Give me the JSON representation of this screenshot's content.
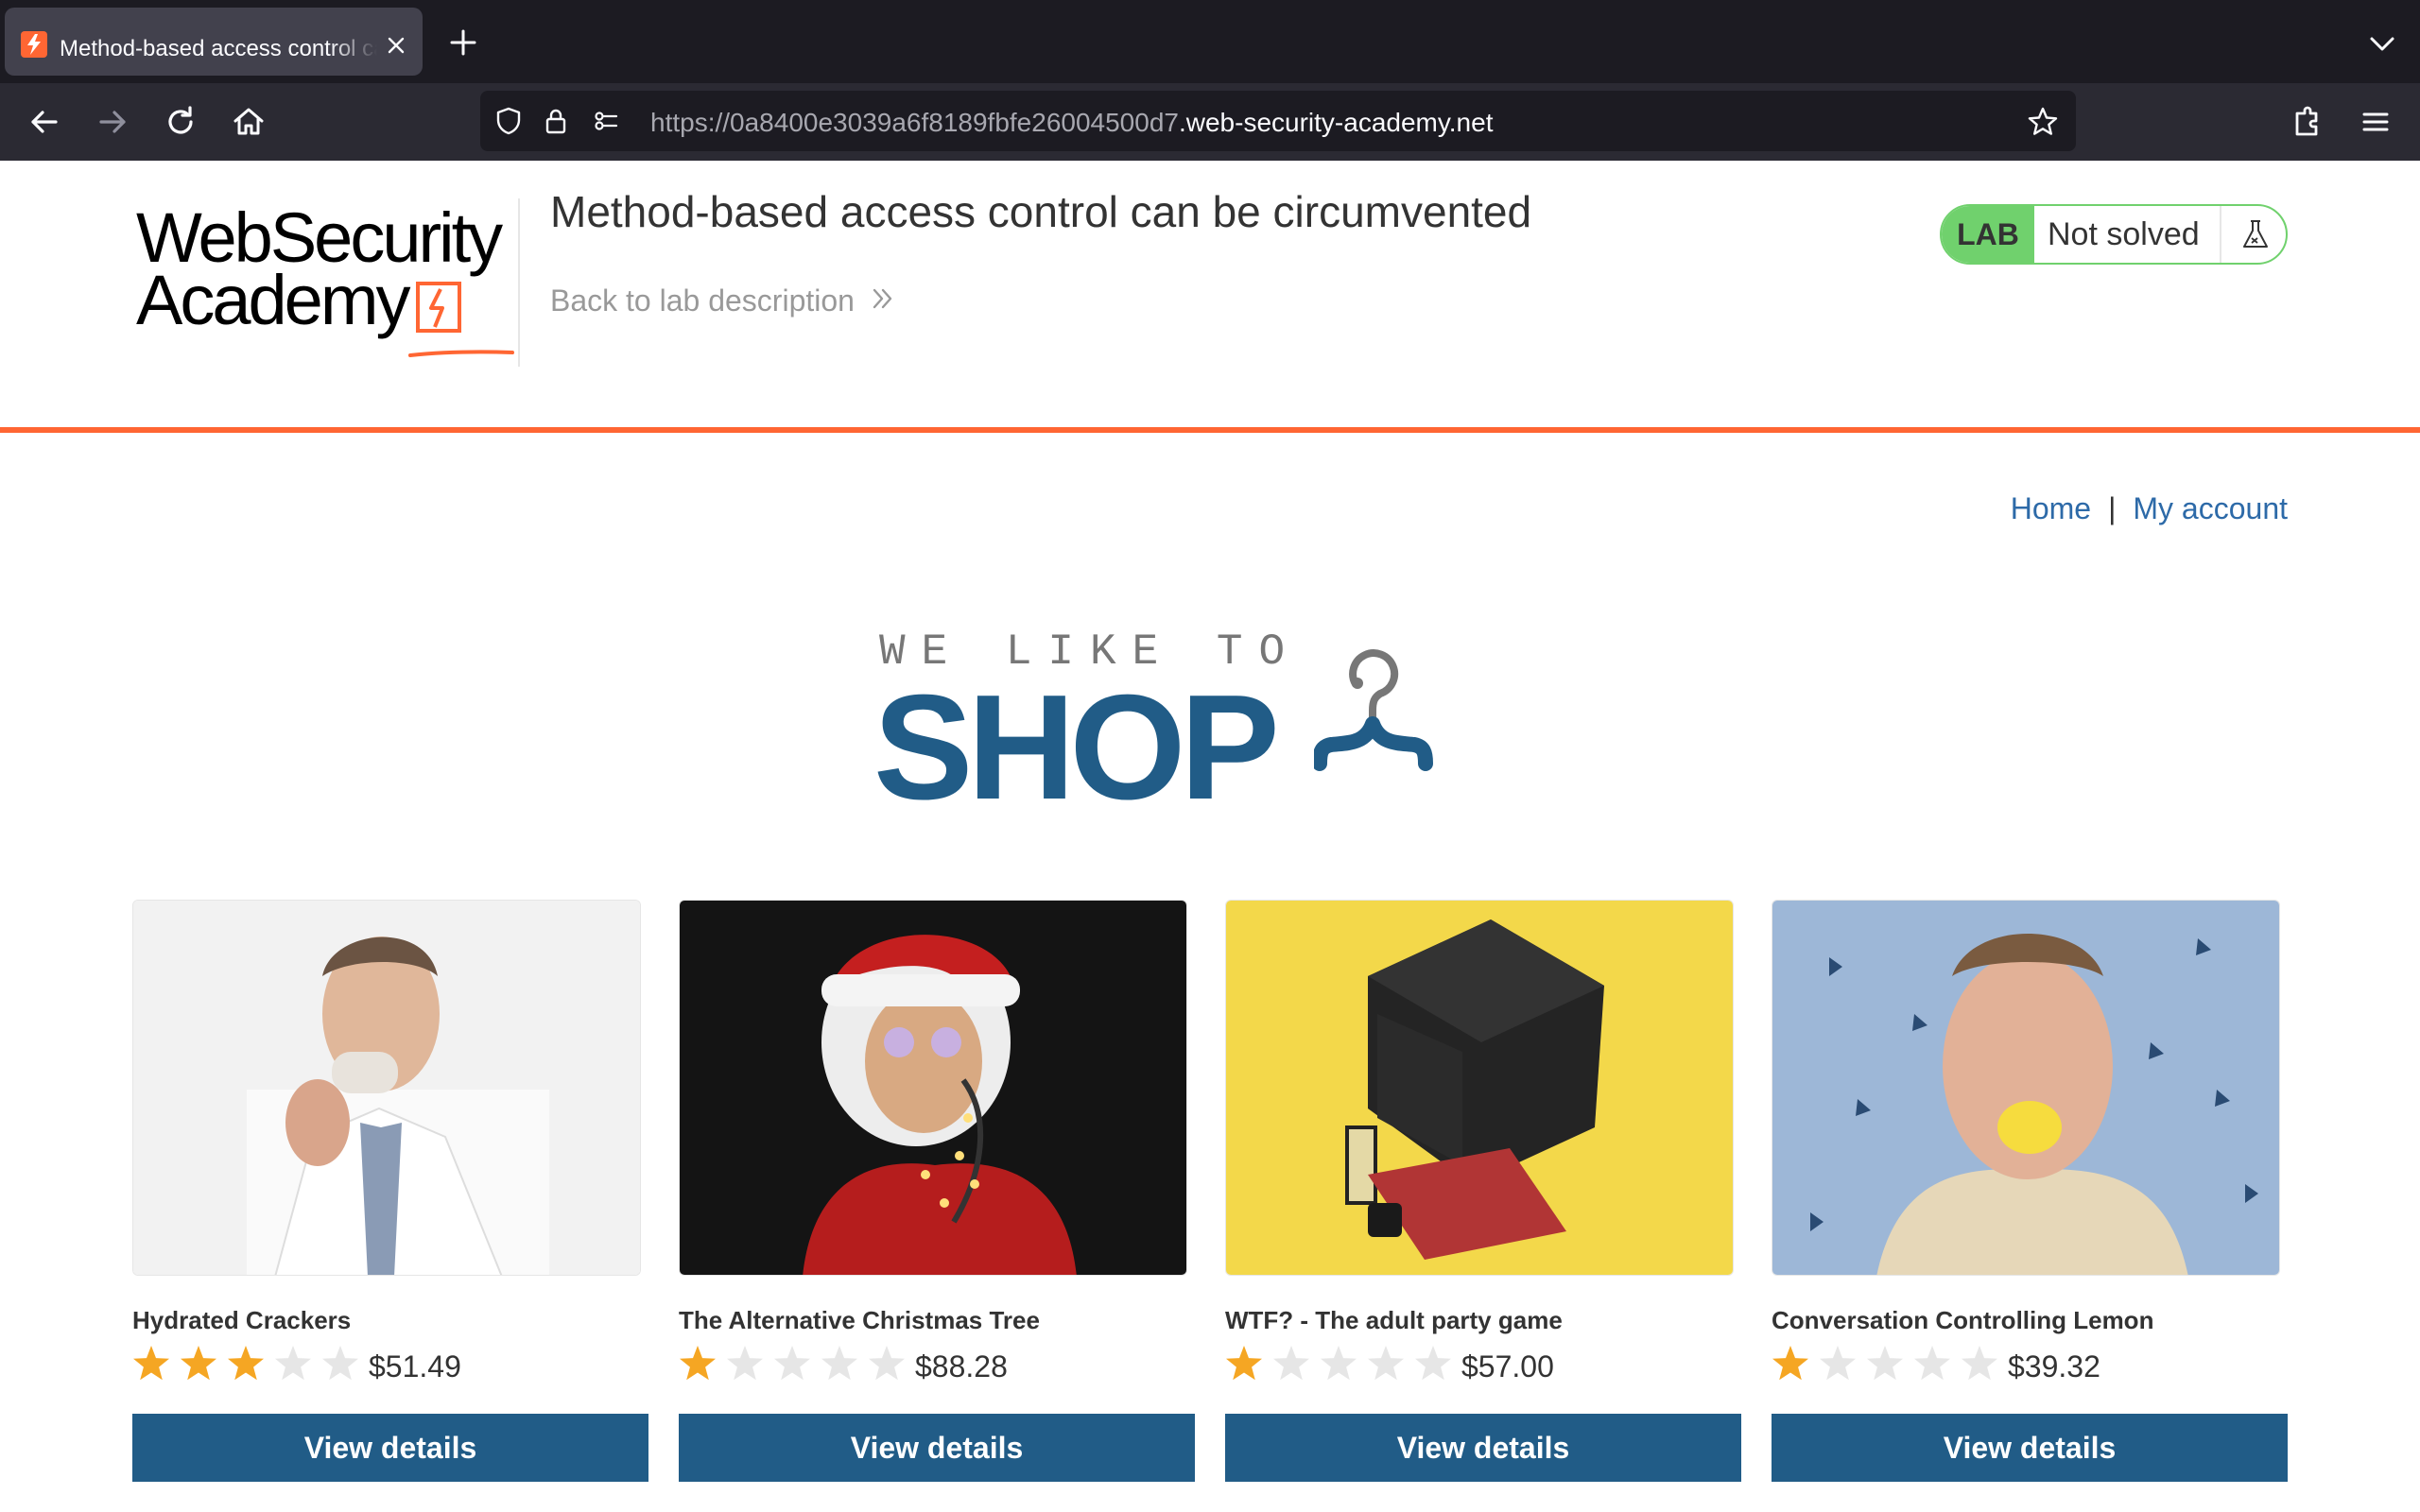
{
  "browser": {
    "tab_title": "Method-based access control can be circumvented",
    "url_prefix": "https://0a8400e3039a6f8189fbfe26004500d7",
    "url_domain": ".web-security-academy.net"
  },
  "lab": {
    "logo_line1": "WebSecurity",
    "logo_line2": "Academy",
    "title": "Method-based access control can be circumvented",
    "back_link": "Back to lab description",
    "badge_label": "LAB",
    "status": "Not solved"
  },
  "colors": {
    "accent_orange": "#ff6633",
    "lab_green": "#70d16d",
    "shop_blue": "#215c87",
    "link_blue": "#2d6aa8",
    "star_gold": "#f5a623",
    "star_grey": "#e6e6e6"
  },
  "nav": {
    "home": "Home",
    "separator": "|",
    "my_account": "My account"
  },
  "banner": {
    "tagline": "WE LIKE TO",
    "headline": "SHOP",
    "icon": "hanger-icon"
  },
  "products": [
    {
      "name": "Hydrated Crackers",
      "rating": 3,
      "price": "$51.49",
      "button": "View details"
    },
    {
      "name": "The Alternative Christmas Tree",
      "rating": 1,
      "price": "$88.28",
      "button": "View details"
    },
    {
      "name": "WTF? - The adult party game",
      "rating": 1,
      "price": "$57.00",
      "button": "View details"
    },
    {
      "name": "Conversation Controlling Lemon",
      "rating": 1,
      "price": "$39.32",
      "button": "View details"
    }
  ],
  "icons": [
    "lightning-icon",
    "close-icon",
    "plus-icon",
    "chevron-down-icon",
    "back-arrow-icon",
    "forward-arrow-icon",
    "reload-icon",
    "home-icon",
    "shield-icon",
    "lock-icon",
    "permissions-icon",
    "star-icon",
    "extensions-icon",
    "menu-icon",
    "flask-icon",
    "double-chevron-icon"
  ]
}
